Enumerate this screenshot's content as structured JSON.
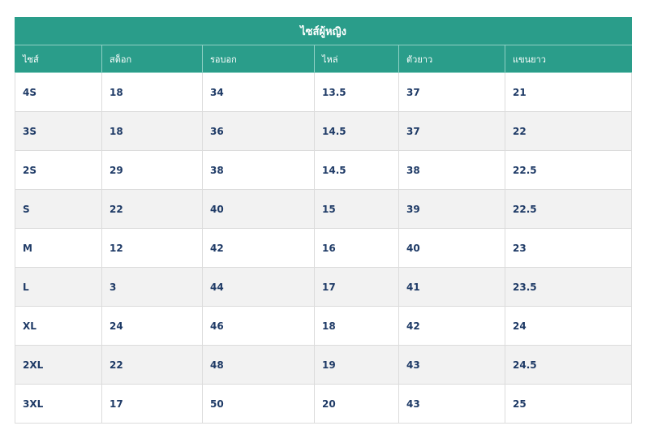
{
  "table": {
    "title": "ไซส์ผู้หญิง",
    "headers": [
      "ไซส์",
      "สต็อก",
      "รอบอก",
      "ไหล่",
      "ตัวยาว",
      "แขนยาว"
    ],
    "rows": [
      [
        "4S",
        "18",
        "34",
        "13.5",
        "37",
        "21"
      ],
      [
        "3S",
        "18",
        "36",
        "14.5",
        "37",
        "22"
      ],
      [
        "2S",
        "29",
        "38",
        "14.5",
        "38",
        "22.5"
      ],
      [
        "S",
        "22",
        "40",
        "15",
        "39",
        "22.5"
      ],
      [
        "M",
        "12",
        "42",
        "16",
        "40",
        "23"
      ],
      [
        "L",
        "3",
        "44",
        "17",
        "41",
        "23.5"
      ],
      [
        "XL",
        "24",
        "46",
        "18",
        "42",
        "24"
      ],
      [
        "2XL",
        "22",
        "48",
        "19",
        "43",
        "24.5"
      ],
      [
        "3XL",
        "17",
        "50",
        "20",
        "43",
        "25"
      ]
    ]
  },
  "colors": {
    "header_bg": "#2a9d8a",
    "cell_text": "#1e3a66",
    "stripe": "#f2f2f2"
  }
}
